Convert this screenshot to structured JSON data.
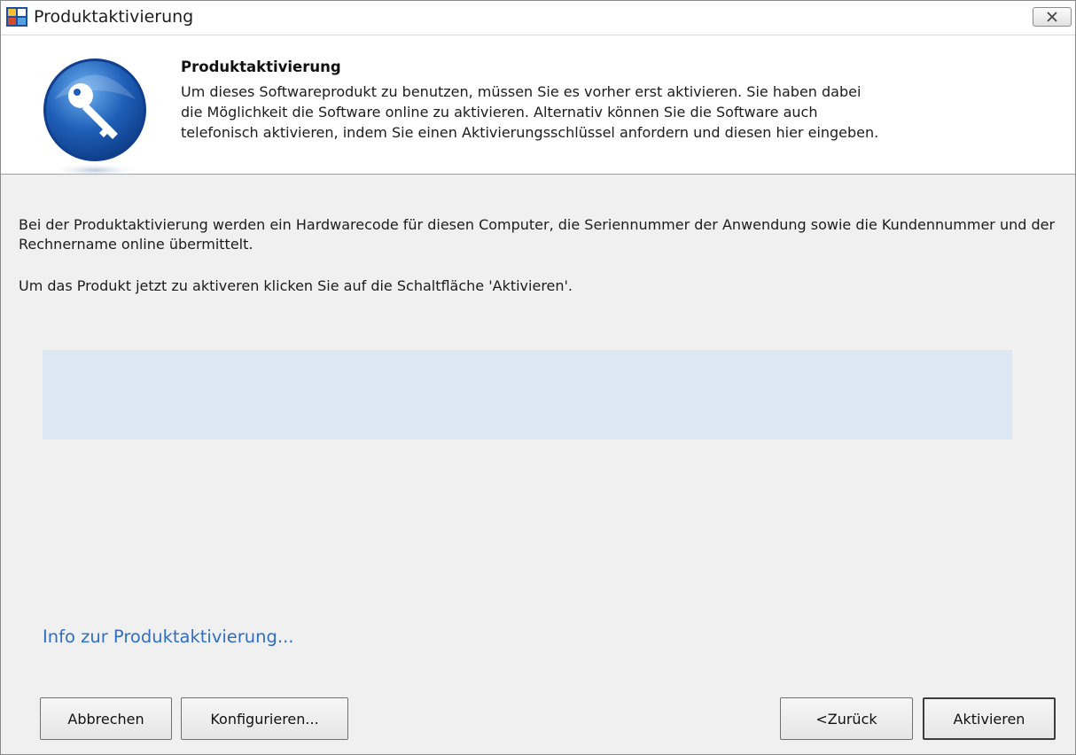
{
  "window": {
    "title": "Produktaktivierung",
    "close_icon": "close-icon"
  },
  "header": {
    "title": "Produktaktivierung",
    "description": "Um dieses Softwareprodukt zu benutzen, müssen Sie es vorher erst aktivieren. Sie haben dabei\ndie Möglichkeit die Software online zu aktivieren. Alternativ können Sie die Software auch\ntelefonisch aktivieren, indem Sie einen Aktivierungsschlüssel anfordern und diesen hier eingeben.",
    "icon": "key-icon"
  },
  "body": {
    "paragraph1": "Bei der Produktaktivierung werden ein Hardwarecode für diesen Computer, die Seriennummer der Anwendung sowie die Kundennummer und der Rechnername online übermittelt.",
    "paragraph2": "Um das Produkt jetzt zu aktiveren klicken Sie auf die Schaltfläche 'Aktivieren'.",
    "info_link": "Info zur Produktaktivierung..."
  },
  "buttons": {
    "cancel": "Abbrechen",
    "configure": "Konfigurieren...",
    "back": "<Zurück",
    "activate": "Aktivieren"
  },
  "colors": {
    "status_panel": "#dde8f5",
    "link": "#2f6fc2",
    "icon_blue": "#1f5fb8"
  }
}
